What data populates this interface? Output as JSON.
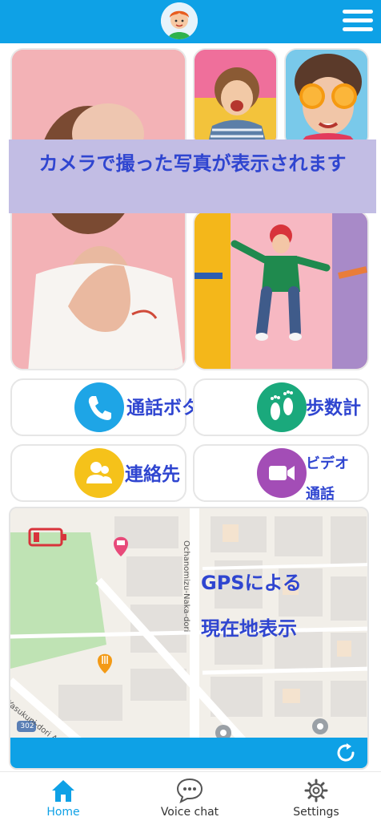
{
  "header": {
    "avatar_icon": "child-avatar",
    "menu_icon": "hamburger-menu",
    "color": "#0ea1e6"
  },
  "photos": {
    "banner_text": "カメラで撮った写真が表示されます"
  },
  "features": {
    "call": {
      "label": "通話ボタン",
      "icon": "phone-icon",
      "color": "#1ea5e6"
    },
    "steps": {
      "label": "歩数計",
      "icon": "footprints-icon",
      "color": "#1aa97c"
    },
    "contacts": {
      "label": "連絡先",
      "icon": "contacts-icon",
      "color": "#f5c21a"
    },
    "video": {
      "label_line1": "ビデオ",
      "label_line2": "通話",
      "icon": "video-camera-icon",
      "color": "#a34db6"
    }
  },
  "map": {
    "gps_line1": "GPSによる",
    "gps_line2": "現在地表示",
    "street_1": "Ochanomizu-Naka-dori",
    "street_2": "Yasukuni-dori Ave",
    "route_number": "302",
    "battery_icon": "battery-low-icon",
    "refresh_icon": "refresh-icon"
  },
  "nav": {
    "home": "Home",
    "voice_chat": "Voice chat",
    "settings": "Settings",
    "active_color": "#0ea1e6"
  }
}
